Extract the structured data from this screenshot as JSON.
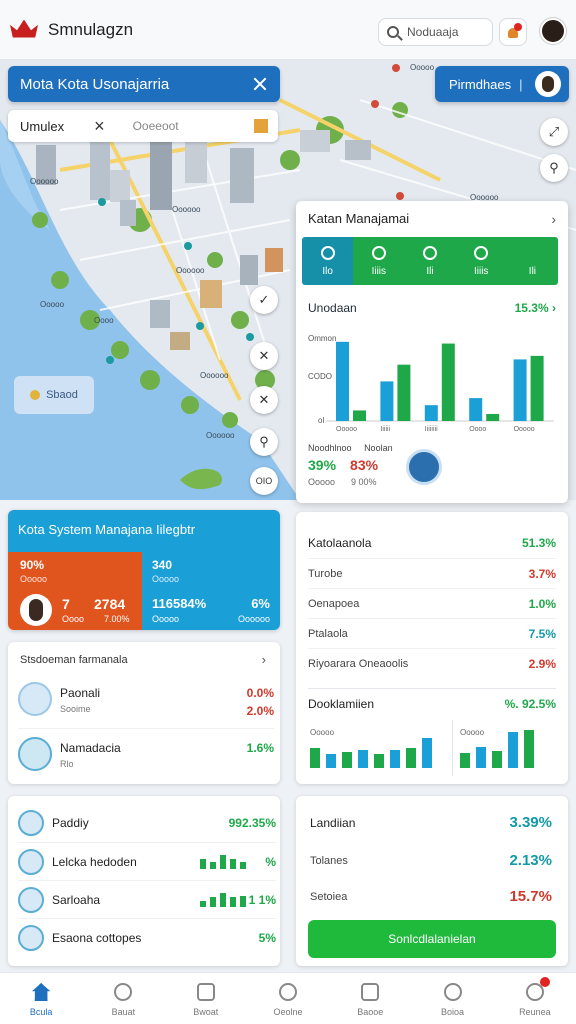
{
  "app": {
    "title": "Smnulagzn",
    "search_value": "Noduaaja"
  },
  "map": {
    "title": "Mota Kota Usonajarria",
    "filter_value": "Umulex",
    "filter_tag": "Ooeeoot",
    "profile_label": "Pirmdhaes",
    "profile_sep": "|",
    "zone_label": "Sbaod",
    "zoom_label": "OIO",
    "control_icons": [
      "expand-icon",
      "pin-icon",
      "compass-icon",
      "layers-icon",
      "locate-icon",
      "pin-icon"
    ]
  },
  "overlay": {
    "title": "Katan Manajamai",
    "tabs": [
      "Ilo",
      "Iiiis",
      "Ili",
      "Iiiis",
      "Ili"
    ],
    "stat_label": "Unodaan",
    "stat_value": "15.3%",
    "chart_ylabels": [
      "Ommon",
      "CODO",
      "ol"
    ],
    "chart_xlabels": [
      "Ooooo",
      "Iiiiii",
      "Iiiiiiii",
      "Oooo",
      "Ooooo"
    ],
    "mini_labels": [
      "Noodhlnoo",
      "Noolan"
    ],
    "mini_values": [
      "39%",
      "83%"
    ],
    "mini_subs": [
      "Ooooo",
      "9 00%"
    ]
  },
  "chart_data": {
    "type": "bar",
    "categories": [
      "Ooooo",
      "Iiiiii",
      "Iiiiiiii",
      "Oooo",
      "Ooooo"
    ],
    "series": [
      {
        "values": [
          90,
          45,
          18,
          26,
          70
        ]
      },
      {
        "values": [
          12,
          64,
          88,
          8,
          74
        ]
      }
    ],
    "ylim": [
      0,
      100
    ],
    "colors": [
      "#1a9fd6",
      "#1fa84a"
    ]
  },
  "kpi": {
    "title": "Kota System Manajana Iilegbtr",
    "left_v1": "90%",
    "left_s1": "Ooooo",
    "left_v2": "7",
    "left_v3": "2784",
    "left_s2": "Oooo",
    "left_s3": "7.00%",
    "right_v1": "340",
    "right_s1": "Ooooo",
    "right_v2": "116584%",
    "right_v3": "6%",
    "right_s2": "Ooooo",
    "right_s3": "Oooooo"
  },
  "list": {
    "title": "Stsdoeman farmanala",
    "rows": [
      {
        "name": "Paonali",
        "sub": "Sooime",
        "v1": "0.0%",
        "v2": "2.0%"
      },
      {
        "name": "Namadacia",
        "sub": "Rlo",
        "v1": "1.6%"
      }
    ]
  },
  "metrics": {
    "rows": [
      {
        "label": "Katolaanola",
        "value": "51.3%"
      },
      {
        "label": "Turobe",
        "value": "3.7%"
      },
      {
        "label": "Oenapoea",
        "value": "1.0%"
      },
      {
        "label": "Ptalaola",
        "value": "7.5%"
      },
      {
        "label": "Riyoarara Oneaoolis",
        "value": "2.9%"
      }
    ]
  },
  "distribution": {
    "title": "Dooklamiien",
    "value": "%. 92.5%",
    "left_label": "Ooooo",
    "right_label": "Ooooo",
    "left_values": [
      20,
      14,
      16,
      18,
      14,
      18,
      20,
      30
    ],
    "right_values": [
      16,
      22,
      18,
      38,
      40
    ]
  },
  "categories_card": {
    "rows": [
      {
        "name": "Paddiy",
        "value": "992.35%"
      },
      {
        "name": "Lelcka hedoden",
        "value": "%",
        "bars": [
          70,
          50,
          100,
          70,
          50
        ]
      },
      {
        "name": "Sarloaha",
        "value": "1 1%",
        "bars": [
          40,
          70,
          100,
          70,
          80
        ]
      },
      {
        "name": "Esaona cottopes",
        "value": "5%"
      }
    ]
  },
  "summary": {
    "rows": [
      {
        "label": "Landiian",
        "value": "3.39%"
      },
      {
        "label": "Tolanes",
        "value": "2.13%"
      },
      {
        "label": "Setoiea",
        "value": "15.7%"
      }
    ],
    "button_label": "Sonlcdlalanielan"
  },
  "nav": {
    "items": [
      "Bcula",
      "Bauat",
      "Bwoat",
      "Oeolne",
      "Baooe",
      "Boioa",
      "Reunea"
    ],
    "active": 0
  }
}
